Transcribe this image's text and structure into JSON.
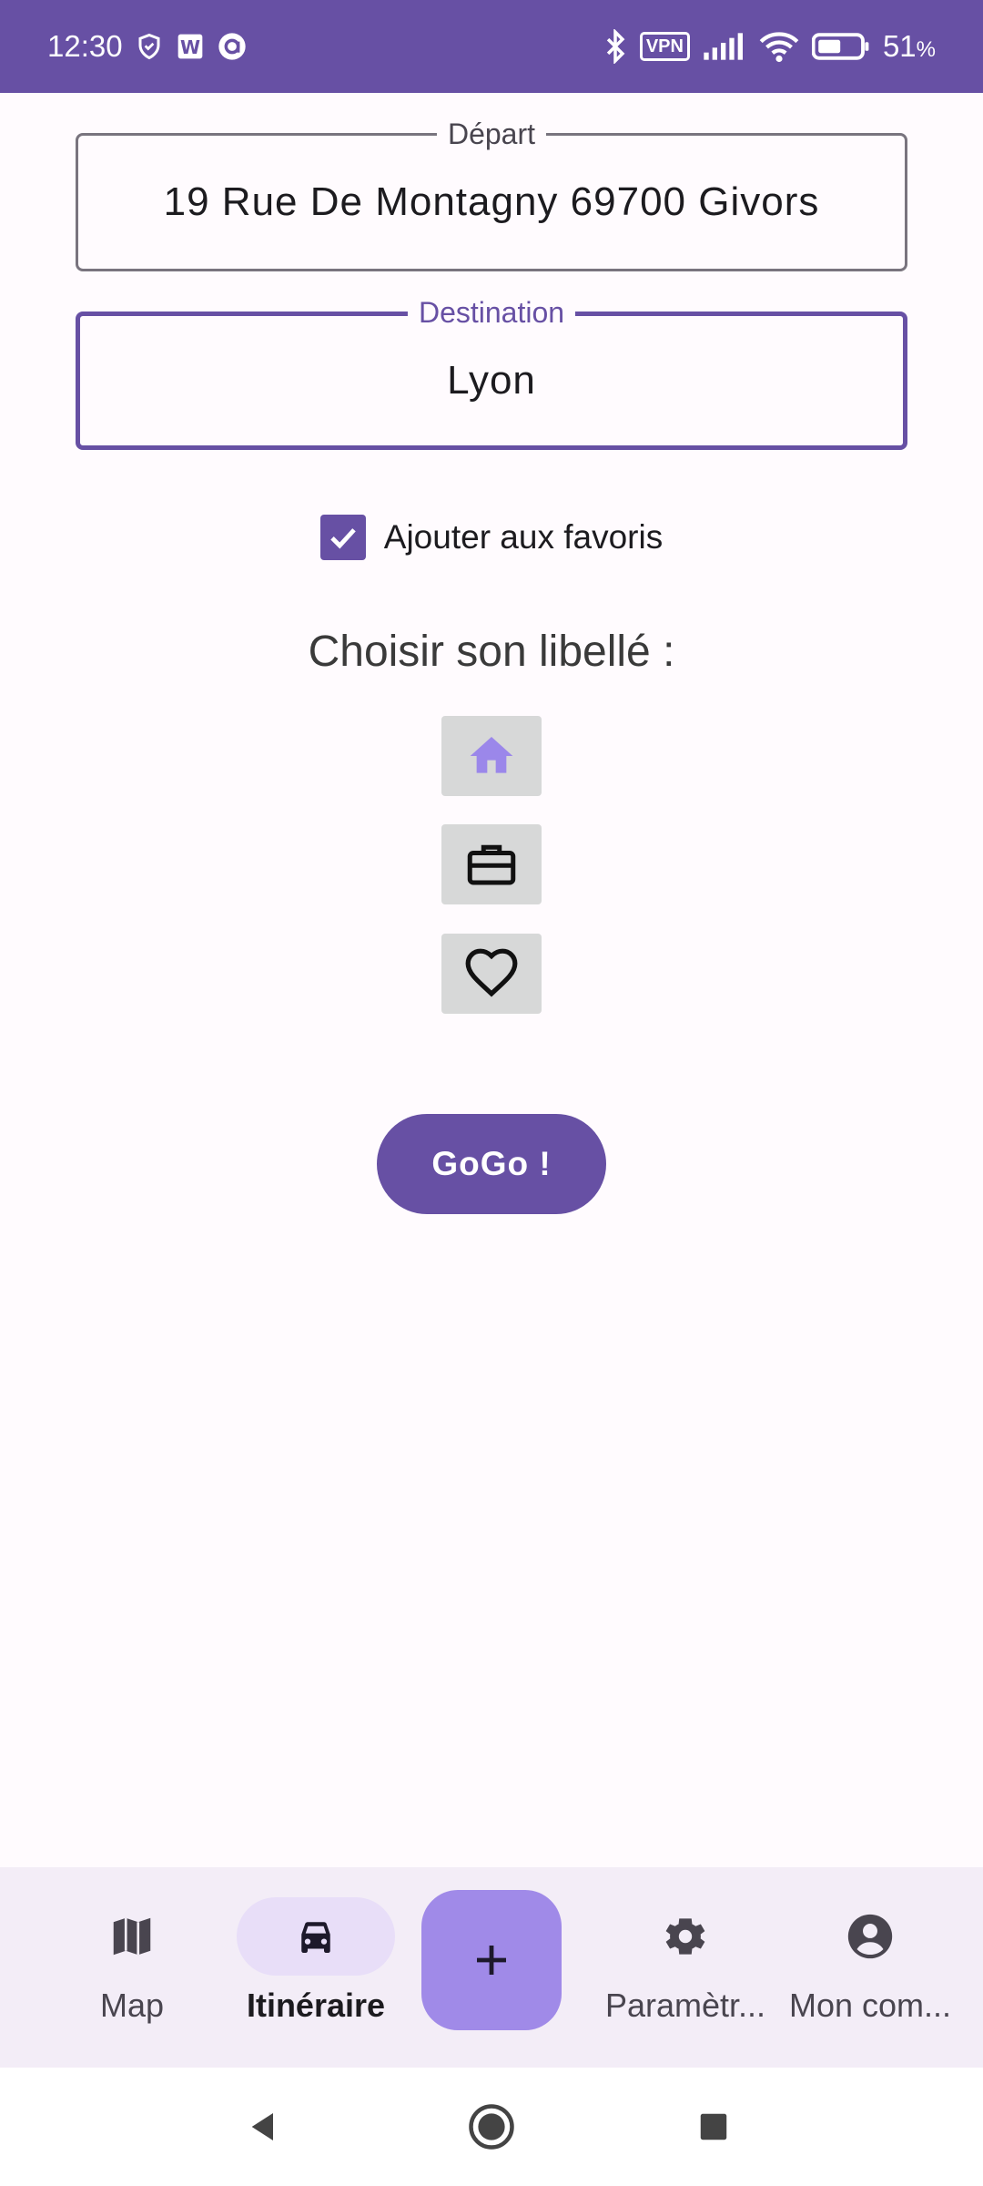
{
  "status_bar": {
    "time": "12:30",
    "vpn_label": "VPN",
    "battery_percent": "51",
    "battery_unit": "%",
    "icons": [
      "shield-icon",
      "w-app-icon",
      "a-app-icon",
      "bluetooth-icon",
      "vpn-icon",
      "signal-icon",
      "wifi-icon",
      "battery-icon"
    ]
  },
  "form": {
    "departure": {
      "label": "Départ",
      "value": "19 Rue De Montagny 69700 Givors"
    },
    "destination": {
      "label": "Destination",
      "value": "Lyon"
    },
    "favorite_checkbox": {
      "label": "Ajouter aux favoris",
      "checked": true
    },
    "label_section_title": "Choisir son libellé :",
    "label_options": [
      {
        "icon": "home-icon",
        "selected": true
      },
      {
        "icon": "briefcase-icon",
        "selected": false
      },
      {
        "icon": "heart-icon",
        "selected": false
      }
    ],
    "submit_label": "GoGo !"
  },
  "bottom_nav": {
    "items": [
      {
        "label": "Map",
        "icon": "map-icon",
        "active": false
      },
      {
        "label": "Itinéraire",
        "icon": "car-icon",
        "active": true
      },
      {
        "label": "Paramètr...",
        "icon": "gear-icon",
        "active": false
      },
      {
        "label": "Mon com...",
        "icon": "account-icon",
        "active": false
      }
    ],
    "fab_icon": "plus-icon"
  },
  "colors": {
    "primary": "#6750a4",
    "fab": "#a08ae8",
    "selected_icon": "#9b87ea",
    "background": "#fffbfe",
    "nav_background": "#f3edf7"
  }
}
